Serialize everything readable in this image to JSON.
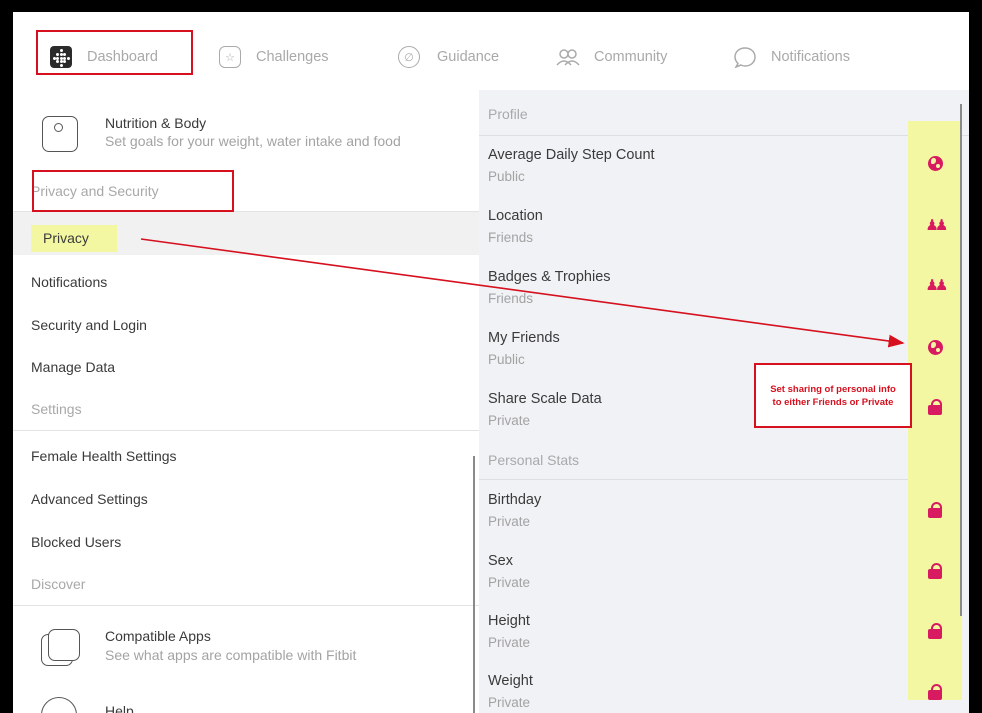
{
  "nav": {
    "items": [
      {
        "label": "Dashboard",
        "icon": "fitbit-logo-icon"
      },
      {
        "label": "Challenges",
        "icon": "star-badge-icon"
      },
      {
        "label": "Guidance",
        "icon": "leaf-icon"
      },
      {
        "label": "Community",
        "icon": "people-icon"
      },
      {
        "label": "Notifications",
        "icon": "speech-bubble-icon"
      }
    ]
  },
  "left": {
    "nutrition": {
      "title": "Nutrition & Body",
      "subtitle": "Set goals for your weight, water intake and food"
    },
    "section_privacy": "Privacy and Security",
    "privacy_items": [
      "Privacy",
      "Notifications",
      "Security and Login",
      "Manage Data"
    ],
    "section_settings": "Settings",
    "settings_items": [
      "Female Health Settings",
      "Advanced Settings",
      "Blocked Users"
    ],
    "section_discover": "Discover",
    "compatible": {
      "title": "Compatible Apps",
      "subtitle": "See what apps are compatible with Fitbit"
    },
    "help": {
      "title": "Help"
    }
  },
  "right": {
    "profile_header": "Profile",
    "profile_items": [
      {
        "title": "Average Daily Step Count",
        "value": "Public",
        "icon": "globe-icon"
      },
      {
        "title": "Location",
        "value": "Friends",
        "icon": "friends-icon"
      },
      {
        "title": "Badges & Trophies",
        "value": "Friends",
        "icon": "friends-icon"
      },
      {
        "title": "My Friends",
        "value": "Public",
        "icon": "globe-icon"
      },
      {
        "title": "Share Scale Data",
        "value": "Private",
        "icon": "lock-icon"
      }
    ],
    "stats_header": "Personal Stats",
    "stats_items": [
      {
        "title": "Birthday",
        "value": "Private",
        "icon": "lock-icon"
      },
      {
        "title": "Sex",
        "value": "Private",
        "icon": "lock-icon"
      },
      {
        "title": "Height",
        "value": "Private",
        "icon": "lock-icon"
      },
      {
        "title": "Weight",
        "value": "Private",
        "icon": "lock-icon"
      }
    ]
  },
  "annotation": {
    "note_line1": "Set sharing of personal info",
    "note_line2": "to either Friends or Private"
  },
  "colors": {
    "highlight": "#f3f7a2",
    "annotation_red": "#d6101e",
    "icon_pink": "#d81b60",
    "panel_bg": "#f0f2f5"
  }
}
